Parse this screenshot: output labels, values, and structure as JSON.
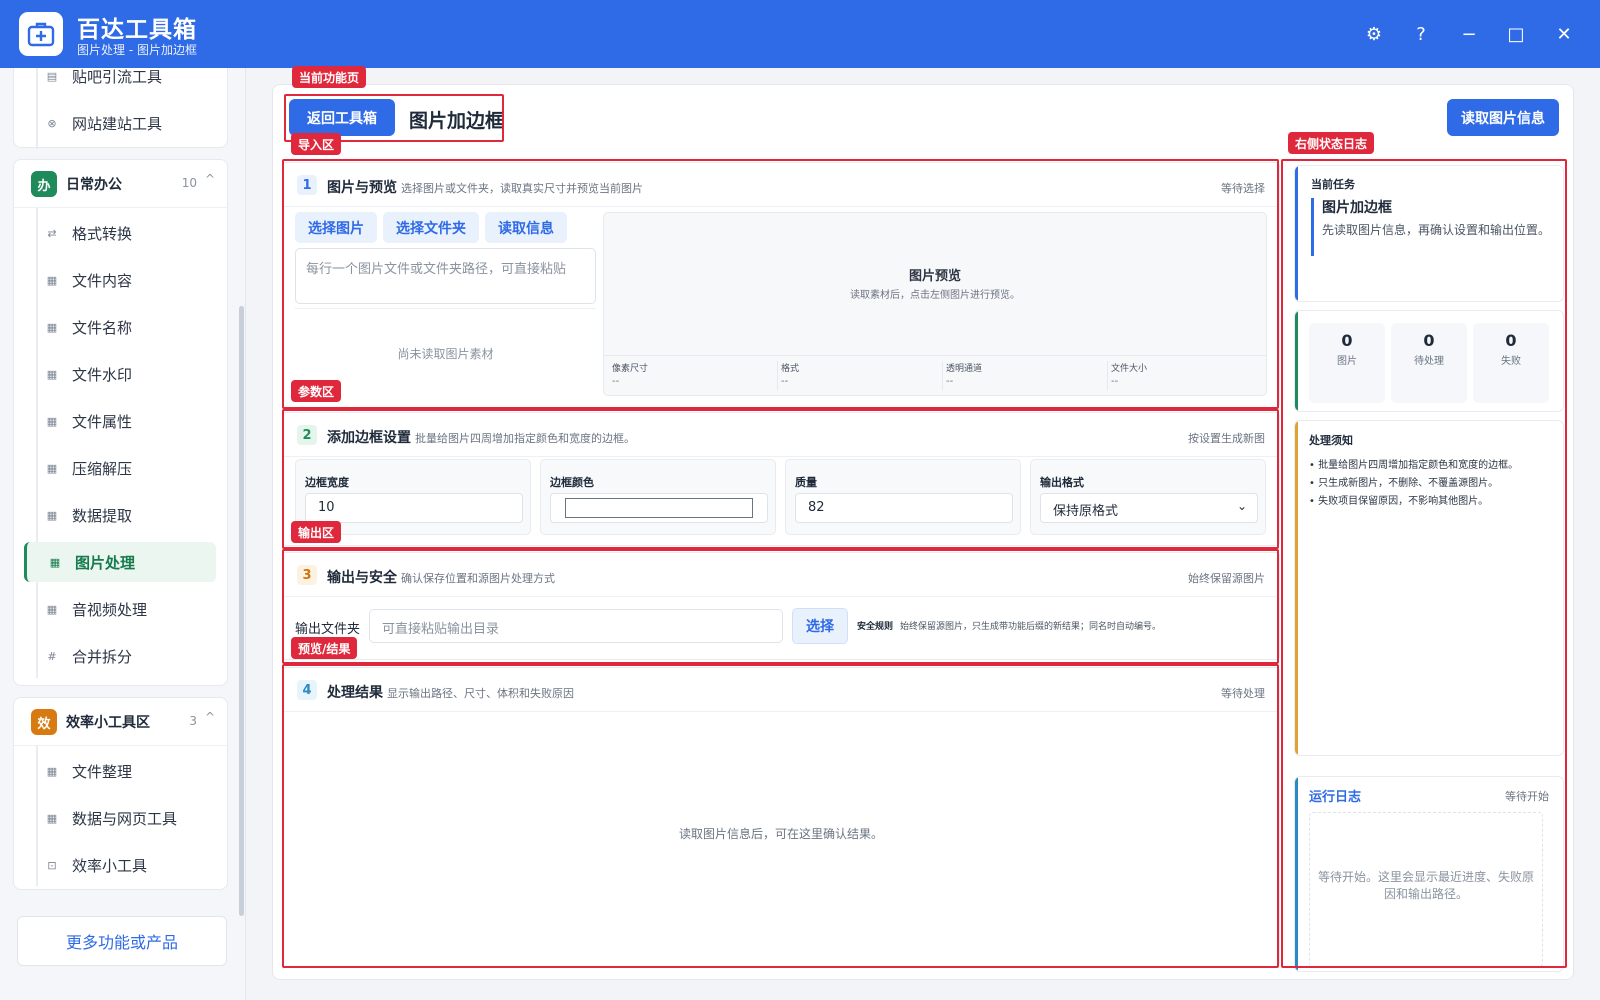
{
  "app": {
    "title": "百达工具箱",
    "subtitle": "图片处理 - 图片加边框",
    "brand_color": "#2f6be6"
  },
  "window_controls": {
    "settings_icon": "⚙",
    "help": "?",
    "minimize": "−",
    "maximize": "□",
    "close": "✕"
  },
  "sidebar": {
    "top_items": [
      {
        "icon": "▤",
        "label": "贴吧引流工具"
      },
      {
        "icon": "⊗",
        "label": "网站建站工具"
      }
    ],
    "groups": [
      {
        "badge": "办",
        "badge_color": "#1f8a5a",
        "name": "日常办公",
        "count": "10",
        "caret": "^",
        "items": [
          {
            "icon": "⇄",
            "label": "格式转换"
          },
          {
            "icon": "▦",
            "label": "文件内容"
          },
          {
            "icon": "▦",
            "label": "文件名称"
          },
          {
            "icon": "▦",
            "label": "文件水印"
          },
          {
            "icon": "▦",
            "label": "文件属性"
          },
          {
            "icon": "▦",
            "label": "压缩解压"
          },
          {
            "icon": "▦",
            "label": "数据提取"
          },
          {
            "icon": "▦",
            "label": "图片处理"
          },
          {
            "icon": "▦",
            "label": "音视频处理"
          },
          {
            "icon": "#",
            "label": "合并拆分"
          }
        ]
      },
      {
        "badge": "效",
        "badge_color": "#d77a12",
        "name": "效率小工具区",
        "count": "3",
        "caret": "^",
        "items": [
          {
            "icon": "▦",
            "label": "文件整理"
          },
          {
            "icon": "▦",
            "label": "数据与网页工具"
          },
          {
            "icon": "⊡",
            "label": "效率小工具"
          }
        ]
      }
    ],
    "more": "更多功能或产品"
  },
  "header": {
    "back": "返回工具箱",
    "title": "图片加边框",
    "read_info": "读取图片信息"
  },
  "sections": {
    "import": {
      "num": "1",
      "title": "图片与预览",
      "desc": "选择图片或文件夹，读取真实尺寸并预览当前图片",
      "status": "等待选择",
      "buttons": [
        "选择图片",
        "选择文件夹",
        "读取信息"
      ],
      "paths_placeholder": "每行一个图片文件或文件夹路径，可直接粘贴",
      "empty": "尚未读取图片素材",
      "preview_title": "图片预览",
      "preview_hint": "读取素材后，点击左侧图片进行预览。",
      "meta": [
        {
          "key": "像素尺寸",
          "value": "--"
        },
        {
          "key": "格式",
          "value": "--"
        },
        {
          "key": "透明通道",
          "value": "--"
        },
        {
          "key": "文件大小",
          "value": "--"
        }
      ]
    },
    "params": {
      "num": "2",
      "title": "添加边框设置",
      "desc": "批量给图片四周增加指定颜色和宽度的边框。",
      "status": "按设置生成新图",
      "border_width_label": "边框宽度",
      "border_width_value": "10",
      "border_color_label": "边框颜色",
      "border_color_value": "#ffffff",
      "quality_label": "质量",
      "quality_value": "82",
      "format_label": "输出格式",
      "format_value": "保持原格式"
    },
    "output": {
      "num": "3",
      "title": "输出与安全",
      "desc": "确认保存位置和源图片处理方式",
      "status": "始终保留源图片",
      "folder_label": "输出文件夹",
      "folder_placeholder": "可直接粘贴输出目录",
      "choose": "选择",
      "rule_label": "安全规则",
      "rule_text": "始终保留源图片，只生成带功能后缀的新结果；同名时自动编号。"
    },
    "result": {
      "num": "4",
      "title": "处理结果",
      "desc": "显示输出路径、尺寸、体积和失败原因",
      "status": "等待处理",
      "empty": "读取图片信息后，可在这里确认结果。"
    }
  },
  "right_panel": {
    "task_label": "当前任务",
    "task_title": "图片加边框",
    "task_desc": "先读取图片信息，再确认设置和输出位置。",
    "stats": [
      {
        "value": "0",
        "label": "图片"
      },
      {
        "value": "0",
        "label": "待处理"
      },
      {
        "value": "0",
        "label": "失败"
      }
    ],
    "notes_title": "处理须知",
    "notes": [
      "批量给图片四周增加指定颜色和宽度的边框。",
      "只生成新图片，不删除、不覆盖源图片。",
      "失败项目保留原因，不影响其他图片。"
    ],
    "log_title": "运行日志",
    "log_status": "等待开始",
    "log_empty": "等待开始。这里会显示最近进度、失败原因和输出路径。"
  },
  "annotations": {
    "current_page": "当前功能页",
    "import_area": "导入区",
    "param_area": "参数区",
    "output_area": "输出区",
    "preview_result": "预览/结果",
    "right_log": "右侧状态日志"
  }
}
